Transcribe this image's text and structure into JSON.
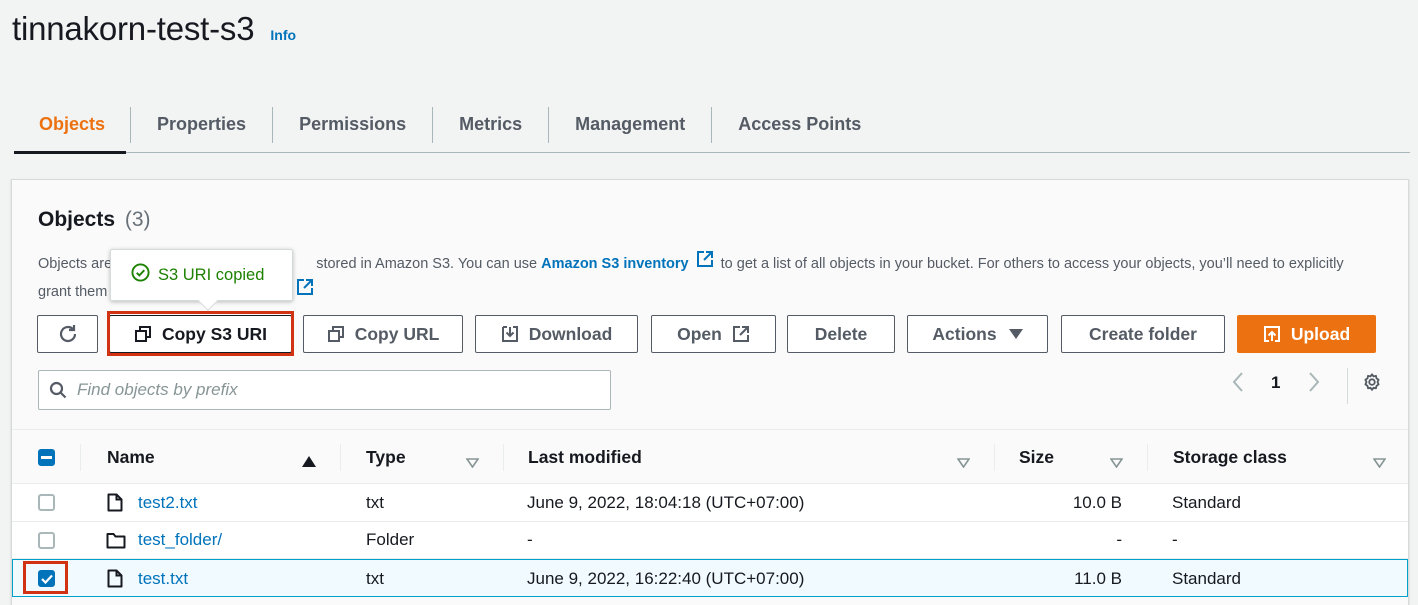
{
  "header": {
    "bucket_name": "tinnakorn-test-s3",
    "info_label": "Info"
  },
  "tabs": [
    {
      "label": "Objects",
      "active": true
    },
    {
      "label": "Properties"
    },
    {
      "label": "Permissions"
    },
    {
      "label": "Metrics"
    },
    {
      "label": "Management"
    },
    {
      "label": "Access Points"
    }
  ],
  "objects_panel": {
    "title": "Objects",
    "count": "(3)",
    "description_pre": "Objects are",
    "description_mid": "stored in Amazon S3. You can use",
    "inventory_link": "Amazon S3 inventory",
    "description_post": "to get a list of all objects in your bucket. For others to access your objects, you’ll need to explicitly",
    "description_line2": "grant them"
  },
  "toast": {
    "message": "S3 URI copied",
    "color": "#1d8102"
  },
  "toolbar": {
    "refresh_icon": "refresh-icon",
    "copy_s3_uri": "Copy S3 URI",
    "copy_url": "Copy URL",
    "download": "Download",
    "open": "Open",
    "delete": "Delete",
    "actions": "Actions",
    "create_folder": "Create folder",
    "upload": "Upload"
  },
  "search": {
    "placeholder": "Find objects by prefix",
    "value": ""
  },
  "pagination": {
    "current_page": "1"
  },
  "table": {
    "columns": [
      "Name",
      "Type",
      "Last modified",
      "Size",
      "Storage class"
    ],
    "rows": [
      {
        "name": "test2.txt",
        "type": "txt",
        "last_modified": "June 9, 2022, 18:04:18 (UTC+07:00)",
        "size": "10.0 B",
        "storage_class": "Standard",
        "selected": false,
        "icon": "file-icon"
      },
      {
        "name": "test_folder/",
        "type": "Folder",
        "last_modified": "-",
        "size": "-",
        "storage_class": "-",
        "selected": false,
        "icon": "folder-icon"
      },
      {
        "name": "test.txt",
        "type": "txt",
        "last_modified": "June 9, 2022, 16:22:40 (UTC+07:00)",
        "size": "11.0 B",
        "storage_class": "Standard",
        "selected": true,
        "icon": "file-icon"
      }
    ]
  },
  "colors": {
    "accent": "#ec7211",
    "link": "#0073bb",
    "highlight_outline": "#d13212"
  }
}
